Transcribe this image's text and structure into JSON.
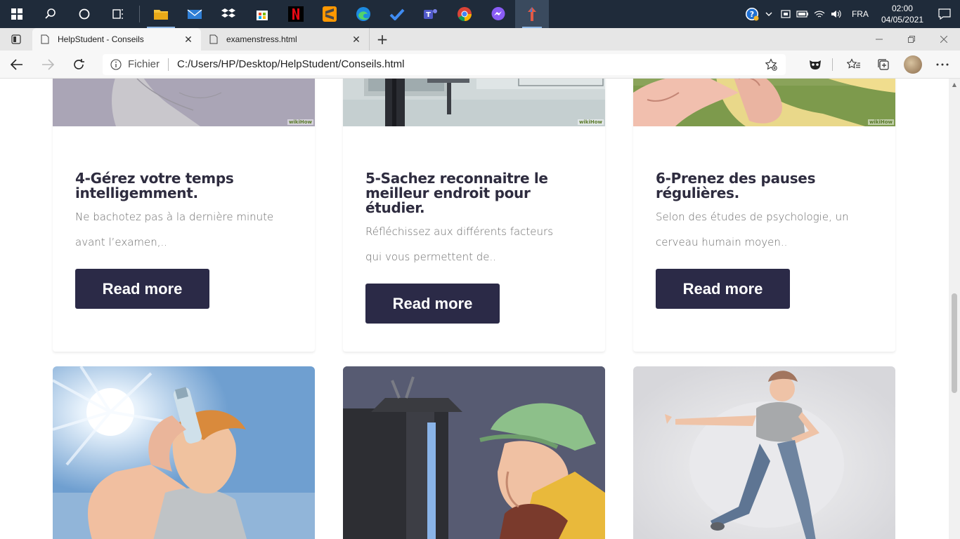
{
  "taskbar": {
    "language": "FRA",
    "time": "02:00",
    "date": "04/05/2021",
    "apps": [
      "start-icon",
      "search-icon",
      "cortana-icon",
      "task-view-icon",
      "file-explorer-icon",
      "mail-icon",
      "dropbox-icon",
      "store-icon",
      "netflix-icon",
      "sublime-icon",
      "edge-icon",
      "todo-icon",
      "teams-icon",
      "chrome-icon",
      "messenger-icon",
      "app-icon"
    ]
  },
  "browser": {
    "tabs": [
      {
        "title": "HelpStudent - Conseils",
        "active": true
      },
      {
        "title": "examenstress.html",
        "active": false
      }
    ],
    "address": {
      "scheme_label": "Fichier",
      "url": "C:/Users/HP/Desktop/HelpStudent/Conseils.html"
    }
  },
  "cards": [
    {
      "title": "4-Gérez votre temps intelligemment.",
      "text": "Ne bachotez pas à la dernière minute avant l’examen,..",
      "button": "Read more",
      "watermark": "wikiHow"
    },
    {
      "title": "5-Sachez reconnaitre le meilleur endroit pour étudier.",
      "text": "Réfléchissez aux différents facteurs qui vous permettent de..",
      "button": "Read more",
      "watermark": "wikiHow"
    },
    {
      "title": "6-Prenez des pauses régulières.",
      "text": "Selon des études de psychologie, un cerveau humain moyen..",
      "button": "Read more",
      "watermark": "wikiHow"
    }
  ],
  "colors": {
    "button_bg": "#2b2a47",
    "title": "#2e2c3f",
    "text": "#6c6c6c",
    "taskbar": "#1f2b3a"
  }
}
